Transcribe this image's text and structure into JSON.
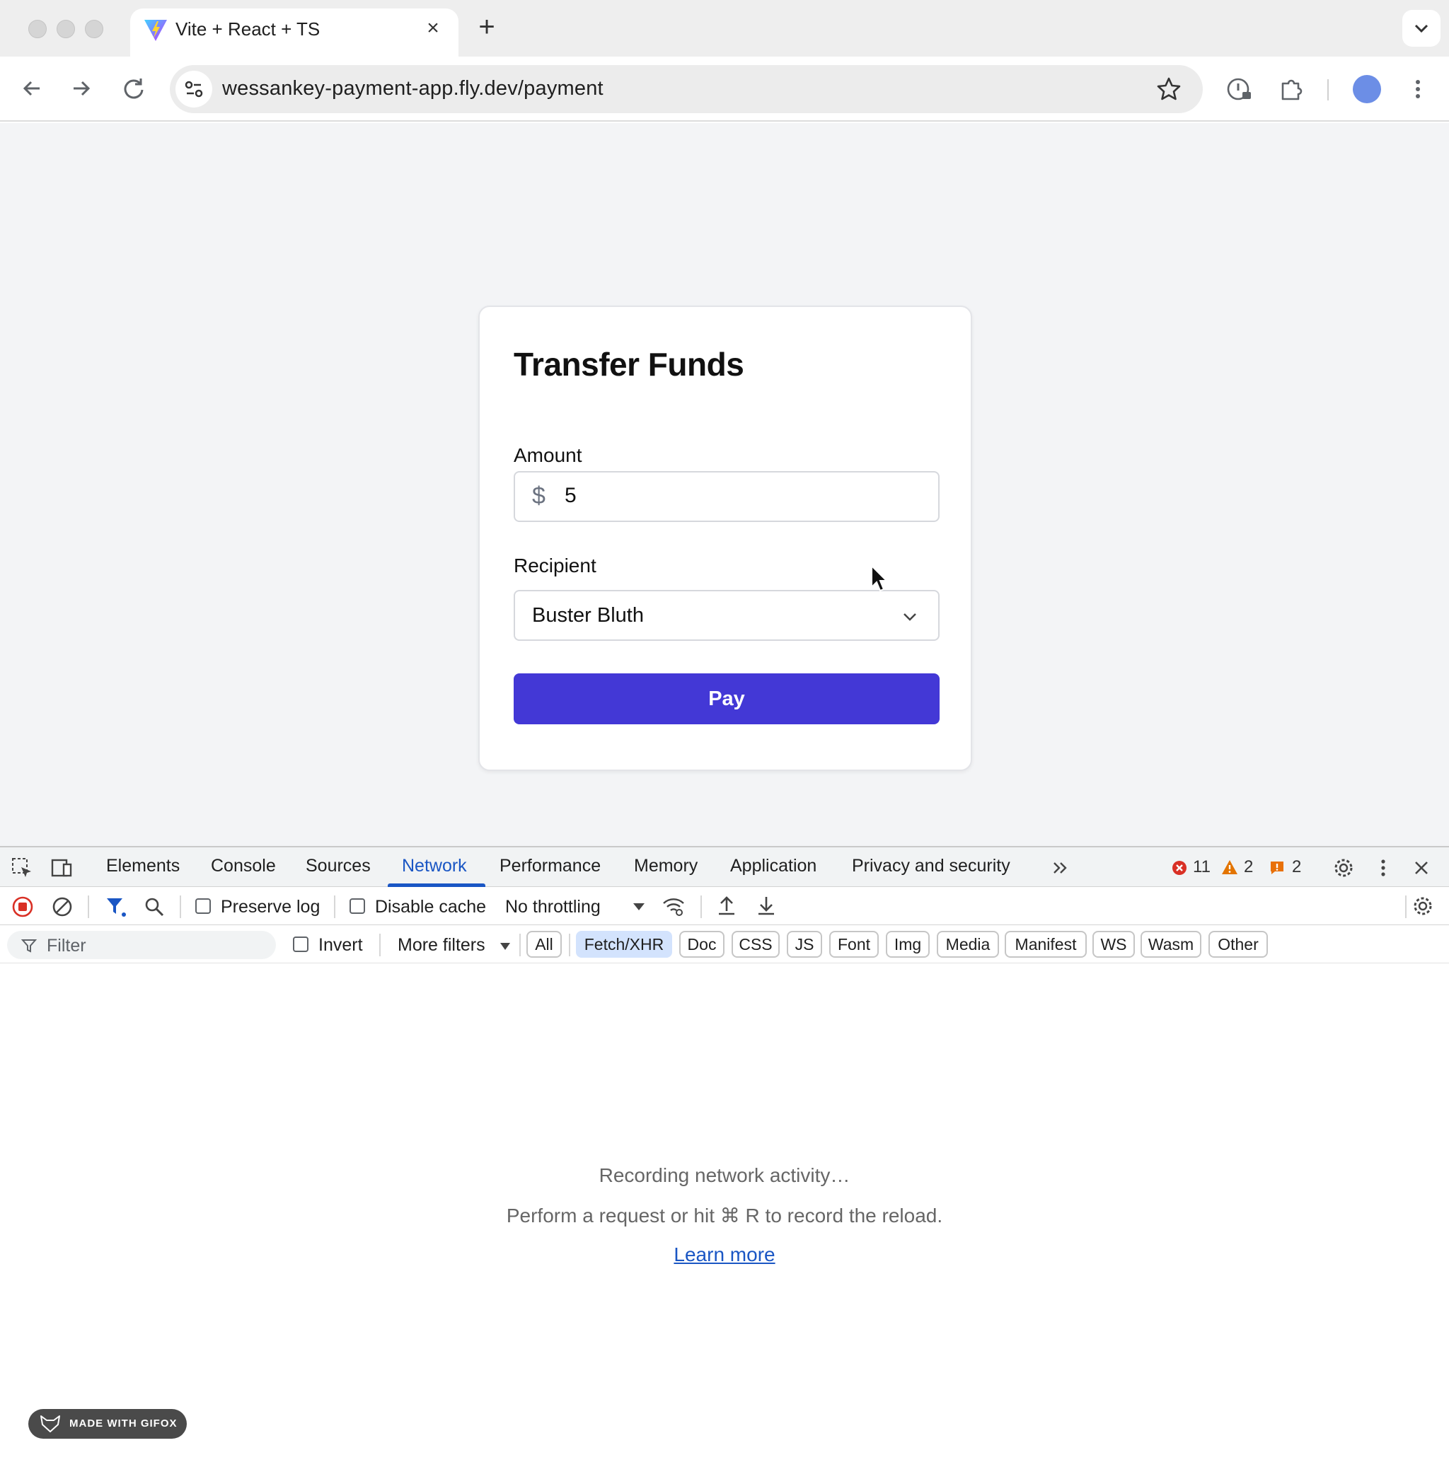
{
  "browser": {
    "tab_title": "Vite + React + TS",
    "url": "wessankey-payment-app.fly.dev/payment"
  },
  "page": {
    "title": "Transfer Funds",
    "amount_label": "Amount",
    "currency_symbol": "$",
    "amount_value": "5",
    "recipient_label": "Recipient",
    "recipient_value": "Buster Bluth",
    "pay_label": "Pay",
    "pay_color": "#4338d6"
  },
  "devtools": {
    "tabs": [
      "Elements",
      "Console",
      "Sources",
      "Network",
      "Performance",
      "Memory",
      "Application",
      "Privacy and security"
    ],
    "active_tab": "Network",
    "errors": "11",
    "warnings": "2",
    "issues": "2",
    "preserve_log": "Preserve log",
    "disable_cache": "Disable cache",
    "throttling": "No throttling",
    "filter_placeholder": "Filter",
    "invert": "Invert",
    "more_filters": "More filters",
    "type_filters": [
      "All",
      "Fetch/XHR",
      "Doc",
      "CSS",
      "JS",
      "Font",
      "Img",
      "Media",
      "Manifest",
      "WS",
      "Wasm",
      "Other"
    ],
    "active_type_filter": "Fetch/XHR",
    "empty_line1": "Recording network activity…",
    "empty_line2": "Perform a request or hit ⌘ R to record the reload.",
    "learn_more": "Learn more"
  },
  "watermark": "MADE WITH GIFOX"
}
